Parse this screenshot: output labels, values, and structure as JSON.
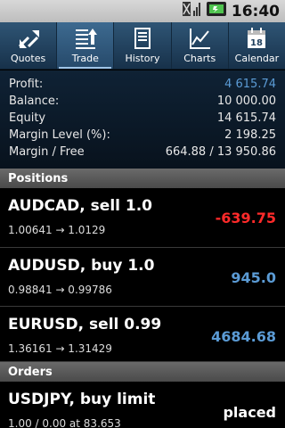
{
  "status": {
    "time": "16:40"
  },
  "tabs": [
    {
      "label": "Quotes",
      "icon": "quotes-arrows-icon"
    },
    {
      "label": "Trade",
      "icon": "trade-list-icon",
      "active": true
    },
    {
      "label": "History",
      "icon": "history-book-icon"
    },
    {
      "label": "Charts",
      "icon": "chart-icon"
    },
    {
      "label": "Calendar",
      "icon": "calendar-icon",
      "day": "18"
    }
  ],
  "summary": [
    {
      "label": "Profit:",
      "value": "4 615.74",
      "color": "#5b9bd5"
    },
    {
      "label": "Balance:",
      "value": "10 000.00"
    },
    {
      "label": "Equity",
      "value": "14 615.74"
    },
    {
      "label": "Margin Level (%):",
      "value": "2 198.25"
    },
    {
      "label": "Margin / Free",
      "value": "664.88 / 13 950.86"
    }
  ],
  "positions_header": "Positions",
  "positions": [
    {
      "title": "AUDCAD, sell 1.0",
      "prices": "1.00641 → 1.0129",
      "profit": "-639.75",
      "color": "#ff2a2a"
    },
    {
      "title": "AUDUSD, buy 1.0",
      "prices": "0.98841 → 0.99786",
      "profit": "945.0",
      "color": "#5b9bd5"
    },
    {
      "title": "EURUSD, sell 0.99",
      "prices": "1.36161 → 1.31429",
      "profit": "4684.68",
      "color": "#5b9bd5"
    }
  ],
  "orders_header": "Orders",
  "orders": [
    {
      "title": "USDJPY, buy limit",
      "prices": "1.00 / 0.00 at 83.653",
      "status": "placed"
    }
  ],
  "colors": {
    "tabbar": "#1f3f5d",
    "profit_positive": "#5b9bd5",
    "profit_negative": "#ff2a2a"
  }
}
